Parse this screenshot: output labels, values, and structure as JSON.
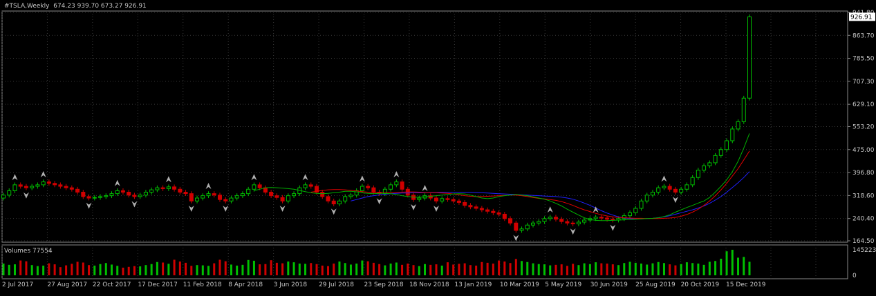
{
  "header": {
    "symbol": "#TSLA,Weekly",
    "ohlc": "674.23 939.70 673.27 926.91"
  },
  "volume_panel": {
    "label": "Volumes 77554"
  },
  "chart_data": {
    "type": "candlestick",
    "price_axis": {
      "ticks": [
        "941.80",
        "863.70",
        "785.50",
        "707.30",
        "629.10",
        "553.20",
        "475.00",
        "396.80",
        "318.60",
        "240.40",
        "164.50"
      ],
      "ylim": [
        164.5,
        941.8
      ],
      "current_price_label": "926.91"
    },
    "volume_axis": {
      "ticks": [
        "145223",
        "0"
      ]
    },
    "x_ticks": [
      "2 Jul 2017",
      "27 Aug 2017",
      "22 Oct 2017",
      "17 Dec 2017",
      "11 Feb 2018",
      "8 Apr 2018",
      "3 Jun 2018",
      "29 Jul 2018",
      "23 Sep 2018",
      "18 Nov 2018",
      "13 Jan 2019",
      "10 Mar 2019",
      "5 May 2019",
      "30 Jun 2019",
      "25 Aug 2019",
      "20 Oct 2019",
      "15 Dec 2019"
    ],
    "close": [
      320,
      335,
      355,
      350,
      345,
      350,
      355,
      365,
      360,
      355,
      350,
      345,
      340,
      330,
      315,
      310,
      312,
      315,
      318,
      325,
      335,
      330,
      320,
      315,
      320,
      330,
      338,
      345,
      342,
      348,
      340,
      330,
      325,
      300,
      310,
      318,
      325,
      320,
      305,
      300,
      310,
      318,
      325,
      340,
      355,
      345,
      330,
      318,
      312,
      300,
      318,
      325,
      345,
      355,
      350,
      330,
      315,
      300,
      290,
      300,
      315,
      320,
      335,
      350,
      345,
      330,
      325,
      340,
      355,
      365,
      340,
      320,
      305,
      310,
      318,
      310,
      300,
      308,
      305,
      300,
      295,
      285,
      280,
      275,
      270,
      265,
      260,
      255,
      240,
      225,
      200,
      205,
      218,
      225,
      230,
      240,
      245,
      238,
      230,
      225,
      222,
      228,
      235,
      240,
      245,
      242,
      238,
      235,
      240,
      250,
      260,
      275,
      300,
      320,
      330,
      345,
      350,
      340,
      330,
      340,
      355,
      380,
      405,
      420,
      430,
      455,
      475,
      505,
      545,
      570,
      650,
      926.91
    ],
    "ma_fast": [
      335,
      340,
      345,
      346,
      345,
      344,
      342,
      340,
      336,
      332,
      328,
      326,
      325,
      326,
      328,
      330,
      333,
      333,
      331,
      328,
      326,
      325,
      326,
      326,
      325,
      322,
      318,
      315,
      313,
      313,
      314,
      316,
      318,
      320,
      322,
      324,
      325,
      324,
      320,
      315,
      310,
      308,
      310,
      315,
      318,
      320,
      322,
      320,
      318,
      314,
      310,
      306,
      300,
      292,
      283,
      272,
      262,
      252,
      243,
      237,
      234,
      233,
      233,
      234,
      235,
      236,
      237,
      238,
      239,
      240,
      241,
      243,
      247,
      253,
      262,
      270,
      278,
      285,
      293,
      300,
      312,
      330,
      350,
      372,
      400,
      435,
      480,
      530
    ],
    "ma_mid": [
      330,
      333,
      336,
      338,
      339,
      339,
      338,
      336,
      334,
      332,
      330,
      329,
      328,
      328,
      328,
      329,
      330,
      331,
      331,
      330,
      329,
      328,
      328,
      327,
      326,
      324,
      321,
      318,
      316,
      315,
      315,
      316,
      317,
      318,
      319,
      320,
      320,
      318,
      315,
      312,
      309,
      307,
      305,
      302,
      298,
      292,
      285,
      277,
      270,
      264,
      258,
      253,
      249,
      246,
      244,
      243,
      242,
      241,
      241,
      240,
      240,
      240,
      241,
      242,
      244,
      248,
      254,
      262,
      272,
      285,
      300,
      318,
      338,
      360,
      385,
      410,
      440,
      470
    ],
    "ma_slow": [
      300,
      305,
      310,
      315,
      318,
      321,
      323,
      325,
      326,
      327,
      327,
      328,
      328,
      328,
      329,
      329,
      330,
      330,
      330,
      330,
      330,
      330,
      329,
      328,
      327,
      326,
      325,
      324,
      323,
      322,
      321,
      320,
      319,
      318,
      317,
      316,
      315,
      313,
      310,
      306,
      300,
      293,
      285,
      276,
      267,
      259,
      252,
      246,
      242,
      240,
      239,
      239,
      240,
      241,
      243,
      246,
      250,
      255,
      260,
      265,
      270,
      276,
      283,
      292,
      303,
      315,
      330,
      346,
      362,
      380,
      400
    ],
    "volume_ticks": [
      "145223",
      "0"
    ],
    "volume_relative": [
      0.46,
      0.41,
      0.43,
      0.58,
      0.55,
      0.4,
      0.36,
      0.38,
      0.47,
      0.43,
      0.32,
      0.39,
      0.45,
      0.53,
      0.5,
      0.4,
      0.38,
      0.44,
      0.48,
      0.42,
      0.37,
      0.3,
      0.33,
      0.36,
      0.35,
      0.4,
      0.44,
      0.52,
      0.5,
      0.45,
      0.61,
      0.54,
      0.49,
      0.37,
      0.4,
      0.39,
      0.37,
      0.47,
      0.61,
      0.55,
      0.42,
      0.38,
      0.41,
      0.6,
      0.57,
      0.43,
      0.44,
      0.59,
      0.49,
      0.47,
      0.54,
      0.51,
      0.46,
      0.45,
      0.48,
      0.44,
      0.38,
      0.36,
      0.46,
      0.54,
      0.48,
      0.42,
      0.46,
      0.58,
      0.55,
      0.49,
      0.44,
      0.39,
      0.46,
      0.5,
      0.41,
      0.46,
      0.4,
      0.36,
      0.44,
      0.41,
      0.43,
      0.38,
      0.51,
      0.42,
      0.45,
      0.47,
      0.4,
      0.38,
      0.52,
      0.49,
      0.46,
      0.58,
      0.54,
      0.48,
      0.64,
      0.56,
      0.52,
      0.47,
      0.44,
      0.43,
      0.39,
      0.41,
      0.43,
      0.37,
      0.45,
      0.4,
      0.47,
      0.44,
      0.51,
      0.47,
      0.46,
      0.43,
      0.4,
      0.48,
      0.53,
      0.49,
      0.46,
      0.42,
      0.47,
      0.52,
      0.48,
      0.43,
      0.39,
      0.44,
      0.51,
      0.48,
      0.46,
      0.41,
      0.53,
      0.56,
      0.65,
      0.94,
      1.0,
      0.69,
      0.72,
      0.53
    ],
    "colors": {
      "background": "#000000",
      "grid": "#3a3a3a",
      "axis_text": "#c8c8c8",
      "bull": "#00c000",
      "bear": "#d00000",
      "ma_fast": "#00b000",
      "ma_mid": "#e00000",
      "ma_slow": "#2020ff",
      "fractal": "#b0b0b0",
      "price_label_bg": "#ffffff",
      "price_label_text": "#000000"
    }
  }
}
